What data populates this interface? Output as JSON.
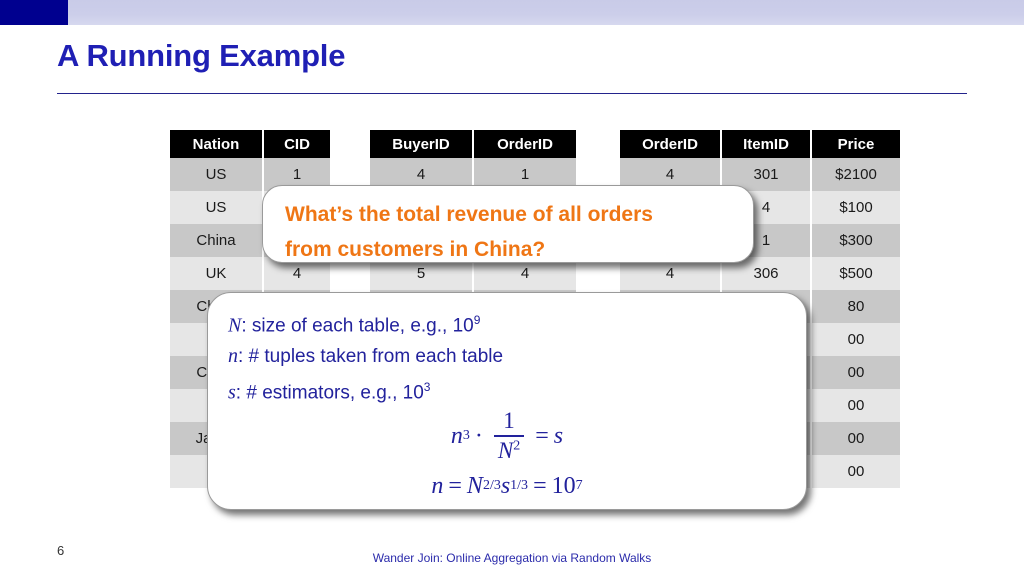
{
  "slide": {
    "title": "A Running Example",
    "page_number": "6",
    "footer": "Wander Join: Online Aggregation via Random Walks",
    "accent_blue": "#1f1fb4",
    "banner_blue": "#00008f",
    "banner_light": "#ccceea",
    "question_orange": "#ef7615",
    "math_blue": "#22229c"
  },
  "tables": {
    "customer": {
      "headers": [
        "Nation",
        "CID"
      ],
      "rows": [
        [
          "US",
          "1"
        ],
        [
          "US",
          ""
        ],
        [
          "China",
          ""
        ],
        [
          "UK",
          "4"
        ],
        [
          "China",
          ""
        ],
        [
          "",
          ""
        ],
        [
          "China",
          ""
        ],
        [
          "",
          ""
        ],
        [
          "Japan",
          ""
        ],
        [
          "",
          ""
        ]
      ]
    },
    "order": {
      "headers": [
        "BuyerID",
        "OrderID"
      ],
      "rows": [
        [
          "4",
          "1"
        ],
        [
          "",
          ""
        ],
        [
          "",
          ""
        ],
        [
          "5",
          "4"
        ],
        [
          "",
          ""
        ],
        [
          "",
          ""
        ],
        [
          "",
          ""
        ],
        [
          "",
          ""
        ],
        [
          "",
          ""
        ],
        [
          "",
          ""
        ]
      ]
    },
    "item": {
      "headers": [
        "OrderID",
        "ItemID",
        "Price"
      ],
      "rows": [
        [
          "4",
          "301",
          "$2100"
        ],
        [
          "",
          "4",
          "$100"
        ],
        [
          "",
          "1",
          "$300"
        ],
        [
          "4",
          "306",
          "$500"
        ],
        [
          "",
          "",
          "80"
        ],
        [
          "",
          "",
          "00"
        ],
        [
          "",
          "",
          "00"
        ],
        [
          "",
          "",
          "00"
        ],
        [
          "",
          "",
          "00"
        ],
        [
          "",
          "",
          "00"
        ]
      ]
    }
  },
  "callout_question": {
    "line1": "What’s the total revenue of all orders",
    "line2": "from customers in China?"
  },
  "callout_math": {
    "line1_var": "N",
    "line1_text": ": size of each table, e.g., 10",
    "line1_exp": "9",
    "line2_var": "n",
    "line2_text": ": # tuples taken from each table",
    "line3_var": "s",
    "line3_text": ": # estimators, e.g., 10",
    "line3_exp": "3",
    "eq1": {
      "lhs_var": "n",
      "lhs_exp": "3",
      "dot": "·",
      "frac_num": "1",
      "frac_den_var": "N",
      "frac_den_exp": "2",
      "eq": "=",
      "rhs": "s"
    },
    "eq2": {
      "lhs": "n",
      "eq1": "=",
      "n_var": "N",
      "n_exp": "2/3",
      "s_var": "s",
      "s_exp": "1/3",
      "eq2": "=",
      "result": "10",
      "result_exp": "7"
    }
  }
}
